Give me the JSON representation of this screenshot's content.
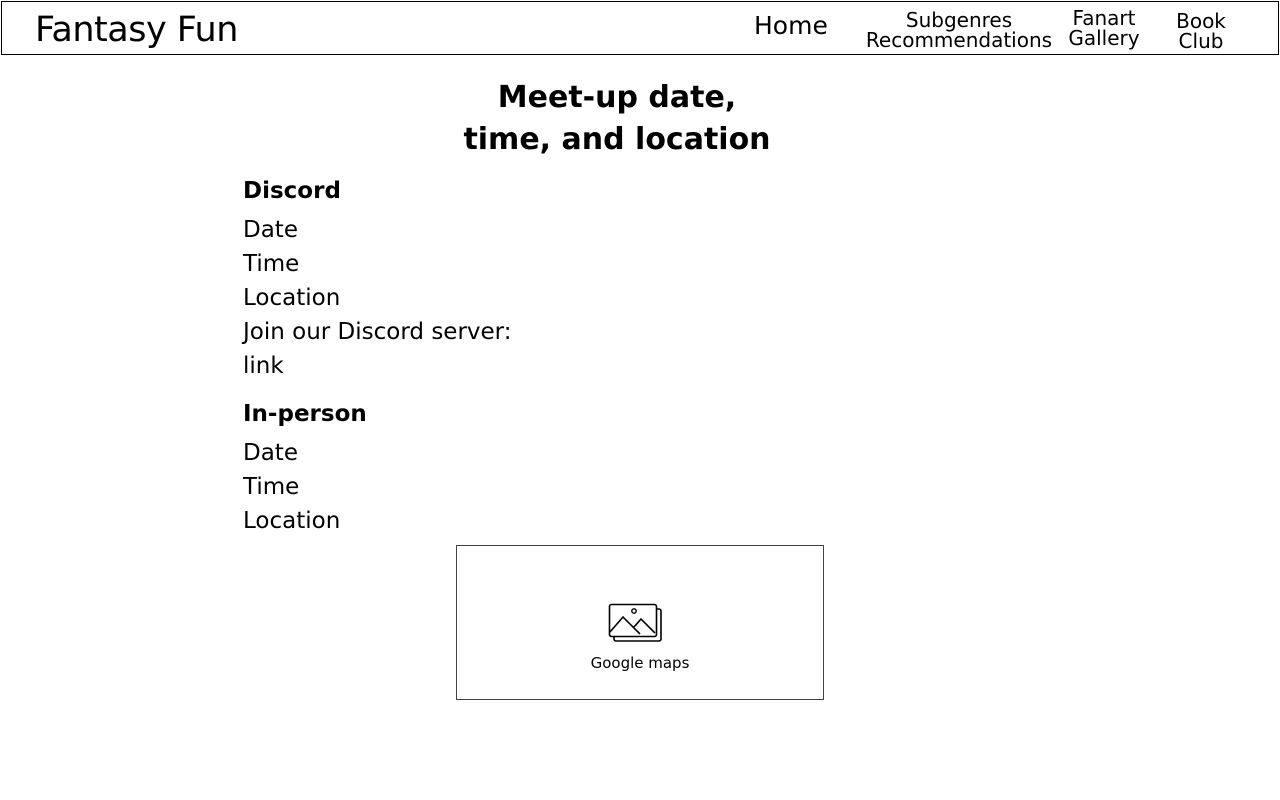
{
  "header": {
    "site_title": "Fantasy Fun",
    "nav": {
      "home": "Home",
      "subgenres_line1": "Subgenres",
      "subgenres_line2": "Recommendations",
      "fanart_line1": "Fanart",
      "fanart_line2": "Gallery",
      "bookclub_line1": "Book",
      "bookclub_line2": "Club"
    }
  },
  "main": {
    "heading_line1": "Meet-up date,",
    "heading_line2": "time, and location",
    "discord": {
      "title": "Discord",
      "date": "Date",
      "time": "Time",
      "location": "Location",
      "join_text": "Join our Discord server:",
      "link": "link"
    },
    "in_person": {
      "title": "In-person",
      "date": "Date",
      "time": "Time",
      "location": "Location"
    },
    "map": {
      "icon": "image-icon",
      "label": "Google maps"
    }
  }
}
